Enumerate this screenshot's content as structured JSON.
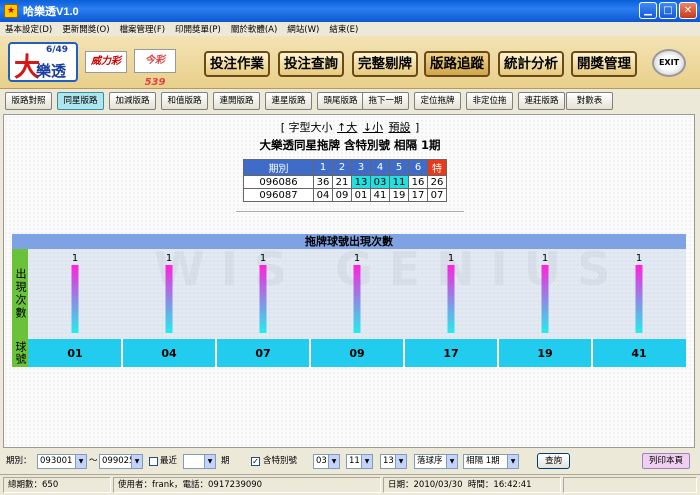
{
  "window": {
    "title": "哈樂透V1.0"
  },
  "menu": [
    "基本設定(D)",
    "更新開獎(O)",
    "檔案管理(F)",
    "印開獎單(P)",
    "關於軟體(A)",
    "網站(W)",
    "結束(E)"
  ],
  "header": {
    "logos": {
      "lotto_num": "6/49",
      "lotto_big": "大",
      "lotto_text": "樂透",
      "power": "威力彩",
      "daily539": "今彩539"
    },
    "buttons": [
      "投注作業",
      "投注查詢",
      "完整剔牌",
      "版路追蹤",
      "統計分析",
      "開獎管理"
    ],
    "exit": "EXIT"
  },
  "subtabs": [
    "版路對照",
    "同星版路",
    "加減版路",
    "和值版路",
    "連開版路",
    "連星版路",
    "頭尾版路",
    "拖下一期",
    "定位拖牌",
    "非定位拖",
    "連莊版路",
    "對數表"
  ],
  "fontctl": {
    "prefix": "[ 字型大小",
    "big": "↑大",
    "small": "↓小",
    "default": "預設",
    "suffix": "]"
  },
  "heading": "大樂透同星拖牌 含特別號 相隔 1期",
  "draws_table": {
    "headers": [
      "期別",
      "1",
      "2",
      "3",
      "4",
      "5",
      "6",
      "特"
    ],
    "rows": [
      [
        "096086",
        "36",
        "21",
        "13",
        "03",
        "11",
        "16",
        "26"
      ],
      [
        "096087",
        "04",
        "09",
        "01",
        "41",
        "19",
        "17",
        "07"
      ]
    ]
  },
  "chart_data": {
    "type": "bar",
    "title": "拖牌球號出現次數",
    "ylabel": "出現次數",
    "xlabel": "球號",
    "categories": [
      "01",
      "04",
      "07",
      "09",
      "17",
      "19",
      "41"
    ],
    "values": [
      1,
      1,
      1,
      1,
      1,
      1,
      1
    ],
    "ylim": [
      0,
      1
    ]
  },
  "controls": {
    "period_label": "期別：",
    "from": "093001",
    "tilde": "～",
    "to": "099025",
    "recent_label": "最近",
    "recent_value": "",
    "period_unit": "期",
    "special_label": "含特別號",
    "special_checked": "✓",
    "sel1": "03",
    "sel2": "11",
    "sel3": "13",
    "order": "落球序",
    "interval": "相隔 1期",
    "query": "查詢",
    "print": "列印本頁"
  },
  "status": {
    "total": "總期數：650",
    "user": "使用者：frank，電話：0917239090",
    "date": "日期：2010/03/30",
    "time": "時間：16:42:41"
  }
}
